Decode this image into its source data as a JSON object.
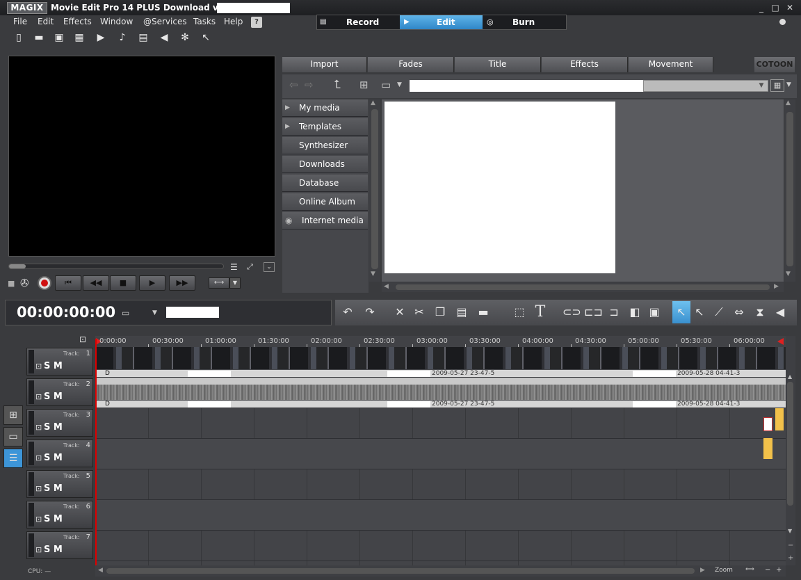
{
  "window": {
    "logo": "MAGIX",
    "title": "Movie Edit Pro 14 PLUS Download version -",
    "controls": [
      "_",
      "□",
      "✕"
    ]
  },
  "menu": [
    "File",
    "Edit",
    "Effects",
    "Window",
    "@Services",
    "Tasks",
    "Help"
  ],
  "toolbar_icons": [
    "new-icon",
    "open-icon",
    "save-icon",
    "capture-icon",
    "render-icon",
    "audio-icon",
    "mixer-icon",
    "speaker-icon",
    "settings-icon",
    "context-help-icon"
  ],
  "modes": [
    {
      "label": "Record",
      "active": false
    },
    {
      "label": "Edit",
      "active": true
    },
    {
      "label": "Burn",
      "active": false
    }
  ],
  "pool_tabs": [
    "Import",
    "Fades",
    "Title",
    "Effects",
    "Movement"
  ],
  "pool_brand": "COTOON",
  "nav_items": [
    {
      "label": "My media",
      "arrow": true
    },
    {
      "label": "Templates",
      "arrow": true
    },
    {
      "label": "Synthesizer",
      "arrow": false
    },
    {
      "label": "Downloads",
      "arrow": false
    },
    {
      "label": "Database",
      "arrow": false
    },
    {
      "label": "Online Album",
      "arrow": false
    },
    {
      "label": "Internet media",
      "arrow": false
    }
  ],
  "timecode": "00:00:00:00",
  "ruler_ticks": [
    "0:00:00",
    "00:30:00",
    "01:00:00",
    "01:30:00",
    "02:00:00",
    "02:30:00",
    "03:00:00",
    "03:30:00",
    "04:00:00",
    "04:30:00",
    "05:00:00",
    "05:30:00",
    "06:00:00"
  ],
  "tracks": [
    {
      "label": "Track:",
      "num": "1",
      "sm": "S M"
    },
    {
      "label": "Track:",
      "num": "2",
      "sm": "S M"
    },
    {
      "label": "Track:",
      "num": "3",
      "sm": "S M"
    },
    {
      "label": "Track:",
      "num": "4",
      "sm": "S M"
    },
    {
      "label": "Track:",
      "num": "5",
      "sm": "S M"
    },
    {
      "label": "Track:",
      "num": "6",
      "sm": "S M"
    },
    {
      "label": "Track:",
      "num": "7",
      "sm": "S M"
    }
  ],
  "clip_labels": {
    "a": "2009-05-27 23-47-5",
    "b": "2009-05-28 04-41-3",
    "d": "D"
  },
  "status": {
    "cpu": "CPU:",
    "cpu_value": "—",
    "zoom": "Zoom"
  }
}
